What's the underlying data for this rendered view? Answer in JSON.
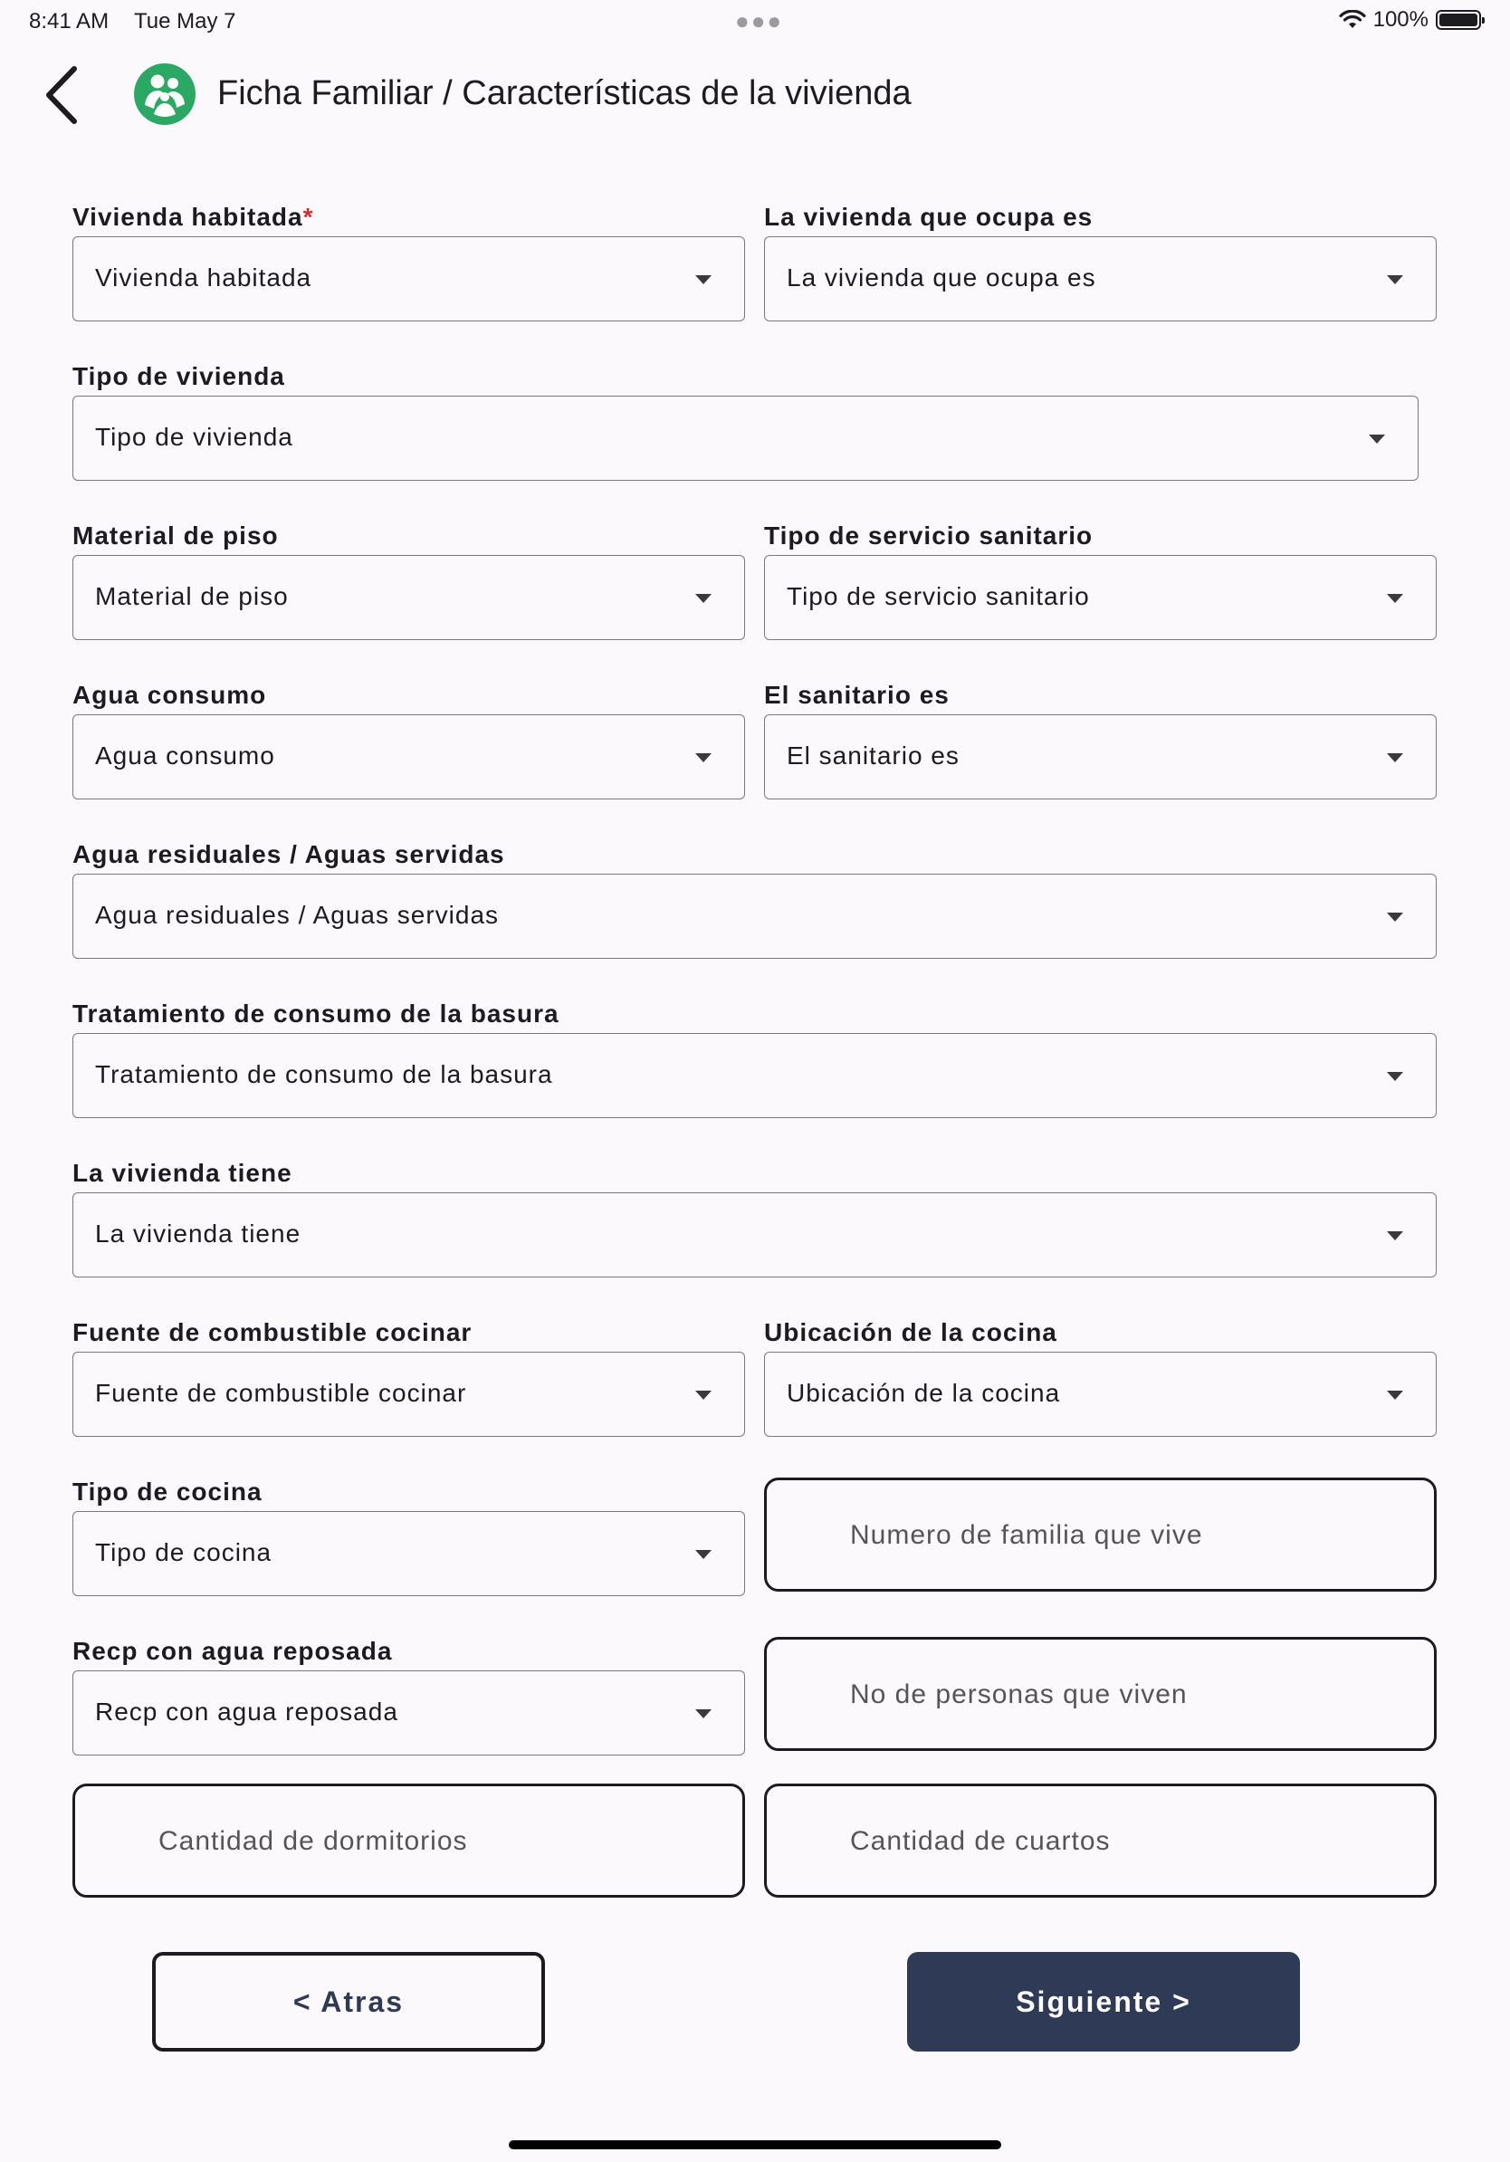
{
  "status_bar": {
    "time": "8:41 AM",
    "date": "Tue May 7",
    "battery_pct": "100%",
    "battery_level": 1.0
  },
  "header": {
    "back_icon": "chevron-left-icon",
    "logo_icon": "family-logo-icon",
    "title": "Ficha Familiar / Características de la vivienda",
    "accent_color": "#2aa864"
  },
  "form": {
    "vivienda_habitada": {
      "label": "Vivienda habitada",
      "required_mark": "*",
      "value": "Vivienda habitada"
    },
    "vivienda_ocupa": {
      "label": "La vivienda que ocupa es",
      "value": "La vivienda que ocupa es"
    },
    "tipo_vivienda": {
      "label": "Tipo de vivienda",
      "value": "Tipo de vivienda"
    },
    "material_piso": {
      "label": "Material de piso",
      "value": "Material de piso"
    },
    "servicio_sanitario": {
      "label": "Tipo de servicio sanitario",
      "value": "Tipo de servicio sanitario"
    },
    "agua_consumo": {
      "label": "Agua consumo",
      "value": "Agua consumo"
    },
    "sanitario_es": {
      "label": "El sanitario es",
      "value": "El sanitario es"
    },
    "aguas_residuales": {
      "label": "Agua residuales / Aguas servidas",
      "value": "Agua residuales / Aguas servidas"
    },
    "tratamiento_basura": {
      "label": "Tratamiento de consumo de la basura",
      "value": "Tratamiento de consumo de la basura"
    },
    "vivienda_tiene": {
      "label": "La vivienda tiene",
      "value": "La vivienda tiene"
    },
    "combustible": {
      "label": "Fuente de combustible cocinar",
      "value": "Fuente de combustible cocinar"
    },
    "ubicacion_cocina": {
      "label": "Ubicación de la cocina",
      "value": "Ubicación de la cocina"
    },
    "tipo_cocina": {
      "label": "Tipo de cocina",
      "value": "Tipo de cocina"
    },
    "agua_reposada": {
      "label": "Recp con agua reposada",
      "value": "Recp con agua reposada"
    },
    "num_familia": {
      "placeholder": "Numero de familia que vive"
    },
    "num_personas": {
      "placeholder": "No de personas que viven"
    },
    "dormitorios": {
      "placeholder": "Cantidad de dormitorios"
    },
    "cuartos": {
      "placeholder": "Cantidad de cuartos"
    }
  },
  "buttons": {
    "back_label": "< Atras",
    "next_label": "Siguiente >",
    "primary_color": "#2f3a56"
  }
}
